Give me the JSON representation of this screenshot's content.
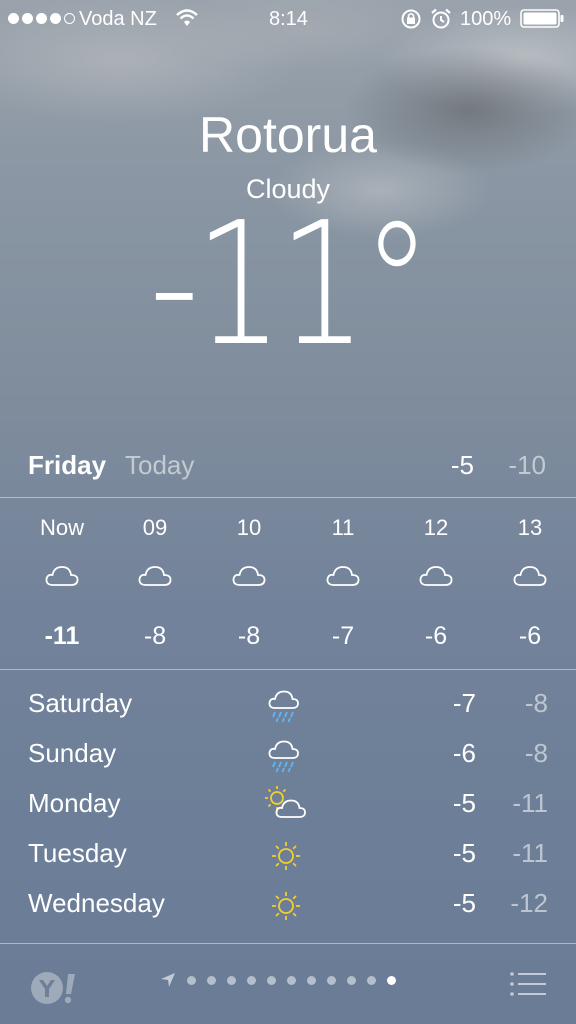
{
  "status_bar": {
    "carrier": "Voda NZ",
    "time": "8:14",
    "battery_percent": "100%",
    "signal_bars": 4,
    "signal_max": 5,
    "icons": [
      "signal-icon",
      "wifi-icon",
      "rotation-lock-icon",
      "alarm-icon",
      "battery-icon"
    ]
  },
  "current": {
    "city": "Rotorua",
    "condition": "Cloudy",
    "temperature": "-11°"
  },
  "today": {
    "day": "Friday",
    "label": "Today",
    "high": "-5",
    "low": "-10"
  },
  "hourly": [
    {
      "time": "Now",
      "icon": "cloud-icon",
      "temp": "-11"
    },
    {
      "time": "09",
      "icon": "cloud-icon",
      "temp": "-8"
    },
    {
      "time": "10",
      "icon": "cloud-icon",
      "temp": "-8"
    },
    {
      "time": "11",
      "icon": "cloud-icon",
      "temp": "-7"
    },
    {
      "time": "12",
      "icon": "cloud-icon",
      "temp": "-6"
    },
    {
      "time": "13",
      "icon": "cloud-icon",
      "temp": "-6"
    }
  ],
  "daily": [
    {
      "day": "Saturday",
      "icon": "rain-cloud-icon",
      "high": "-7",
      "low": "-8"
    },
    {
      "day": "Sunday",
      "icon": "rain-cloud-icon",
      "high": "-6",
      "low": "-8"
    },
    {
      "day": "Monday",
      "icon": "partly-sunny-icon",
      "high": "-5",
      "low": "-11"
    },
    {
      "day": "Tuesday",
      "icon": "sun-icon",
      "high": "-5",
      "low": "-11"
    },
    {
      "day": "Wednesday",
      "icon": "sun-icon",
      "high": "-5",
      "low": "-12"
    }
  ],
  "footer": {
    "page_count": 11,
    "active_page": 11,
    "icons": [
      "yahoo-logo",
      "location-arrow-icon",
      "list-icon"
    ]
  },
  "colors": {
    "text": "#ffffff",
    "muted_text": "#c9d0d8",
    "sun": "#f2cf2e",
    "rain": "#5fb6f2"
  }
}
